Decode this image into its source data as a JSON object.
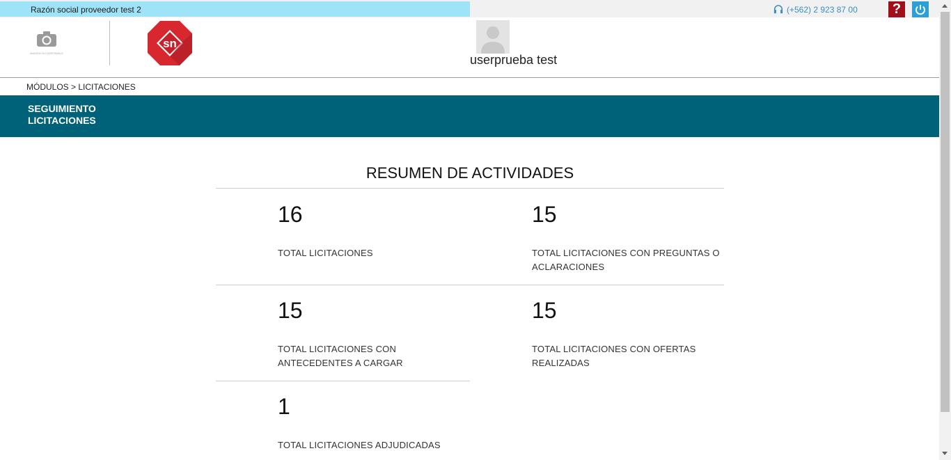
{
  "topbar": {
    "company_name": "Razón social proveedor test 2",
    "phone": "(+562) 2 923 87 00",
    "help_label": "?",
    "colors": {
      "company_bg": "#9ee3f7",
      "help_bg": "#a00f1a",
      "power_bg": "#2aa0d6",
      "phone": "#3b8ec2"
    }
  },
  "header": {
    "company_image_caption": "IMAGEN NO DISPONIBLE",
    "logo_text": "sn",
    "username": "userprueba test"
  },
  "breadcrumb": "MÓDULOS > LICITACIONES",
  "section": {
    "title": "SEGUIMIENTO\nLICITACIONES",
    "color": "#006279"
  },
  "summary": {
    "title": "RESUMEN DE ACTIVIDADES",
    "stats": [
      {
        "value": "16",
        "label": "TOTAL LICITACIONES"
      },
      {
        "value": "15",
        "label": "TOTAL LICITACIONES CON PREGUNTAS O ACLARACIONES"
      },
      {
        "value": "15",
        "label": "TOTAL LICITACIONES CON ANTECEDENTES A CARGAR"
      },
      {
        "value": "15",
        "label": "TOTAL LICITACIONES CON OFERTAS REALIZADAS"
      },
      {
        "value": "1",
        "label": "TOTAL LICITACIONES ADJUDICADAS"
      }
    ]
  }
}
